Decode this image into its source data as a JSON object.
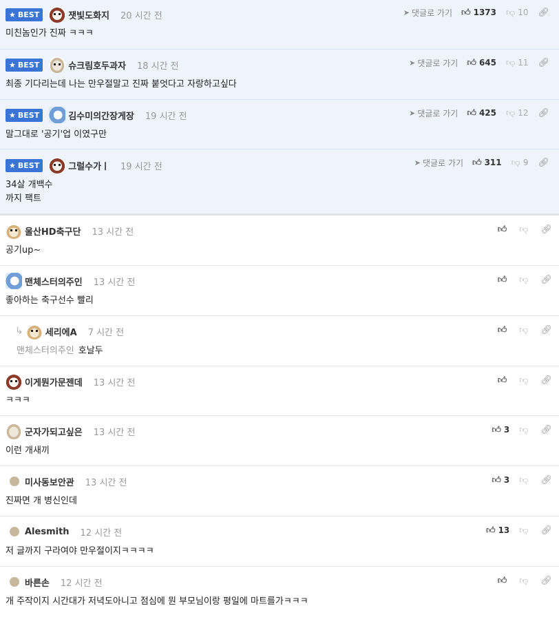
{
  "best_label": "BEST",
  "goto_label": "댓글로 가기",
  "best_comments": [
    {
      "nick": "잿빛도화지",
      "time": "20 시간 전",
      "text": "미친놈인가 진짜 ㅋㅋㅋ",
      "likes": "1373",
      "dislikes": "10",
      "avatar": "dog-red"
    },
    {
      "nick": "슈크림호두과자",
      "time": "18 시간 전",
      "text": "최종 기다리는데 나는 만우절말고 진짜 붙엇다고 자랑하고싶다",
      "likes": "645",
      "dislikes": "11",
      "avatar": "shih"
    },
    {
      "nick": "김수미의간장게장",
      "time": "19 시간 전",
      "text": "말그대로 '공기'업 이였구만",
      "likes": "425",
      "dislikes": "12",
      "avatar": "blue"
    },
    {
      "nick": "그럴수가ㅣ",
      "time": "19 시간 전",
      "text_line1": "34살 개백수",
      "text_line2": "까지 팩트",
      "likes": "311",
      "dislikes": "9",
      "avatar": "dog-red"
    }
  ],
  "comments": [
    {
      "nick": "울산HD축구단",
      "time": "13 시간 전",
      "text": "공기up~",
      "likes": "",
      "avatar": "fox"
    },
    {
      "nick": "맨체스터의주인",
      "time": "13 시간 전",
      "text": "좋아하는 축구선수 빨리",
      "likes": "",
      "avatar": "blue"
    },
    {
      "nick": "세리에A",
      "time": "7 시간 전",
      "mention": "맨체스터의주인",
      "text": "호날두",
      "likes": "",
      "avatar": "fox",
      "reply": true
    },
    {
      "nick": "이게뭔가문젠데",
      "time": "13 시간 전",
      "text": "ㅋㅋㅋ",
      "likes": "",
      "avatar": "dog-red"
    },
    {
      "nick": "군자가되고싶은",
      "time": "13 시간 전",
      "text": "이런 개새끼",
      "likes": "3",
      "avatar": "shih"
    },
    {
      "nick": "미사동보안관",
      "time": "13 시간 전",
      "text": "진짜면 개 병신인데",
      "likes": "3",
      "avatar": "dot"
    },
    {
      "nick": "Alesmith",
      "time": "12 시간 전",
      "text": "저 글까지 구라여야 만우절이지ㅋㅋㅋㅋ",
      "likes": "13",
      "avatar": "dot"
    },
    {
      "nick": "바른손",
      "time": "12 시간 전",
      "text": "개 주작이지 시간대가 저녁도아니고 점심에 뭔 부모님이랑 평일에 마트를가ㅋㅋㅋ",
      "likes": "",
      "avatar": "dot"
    }
  ]
}
